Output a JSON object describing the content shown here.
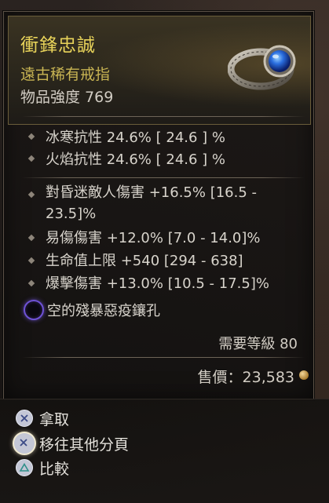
{
  "item": {
    "name": "衝鋒忠誠",
    "type": "遠古稀有戒指",
    "power": "物品強度 769",
    "icon": "sapphire-ring-icon"
  },
  "resistances": [
    "冰寒抗性 24.6%  [ 24.6 ] %",
    "火焰抗性 24.6%  [ 24.6 ] %"
  ],
  "affixes": [
    "對昏迷敵人傷害 +16.5% [16.5 - 23.5]%",
    "易傷傷害 +12.0% [7.0 - 14.0]%",
    "生命值上限 +540 [294 - 638]",
    "爆擊傷害 +13.0% [10.5 - 17.5]%"
  ],
  "socket": {
    "label": "空的殘暴惡疫鑲孔",
    "color": "#6e52d6"
  },
  "requirement": "需要等級 80",
  "sell_price": "售價：23,583",
  "controls": [
    {
      "label": "拿取",
      "button": "cross-button-icon"
    },
    {
      "label": "移往其他分頁",
      "button": "cross-button-icon"
    },
    {
      "label": "比較",
      "button": "triangle-button-icon"
    }
  ],
  "colors": {
    "legendary_name": "#e8d35a",
    "rarity_text": "#c8b453",
    "stat_text": "#d8d4cc"
  }
}
